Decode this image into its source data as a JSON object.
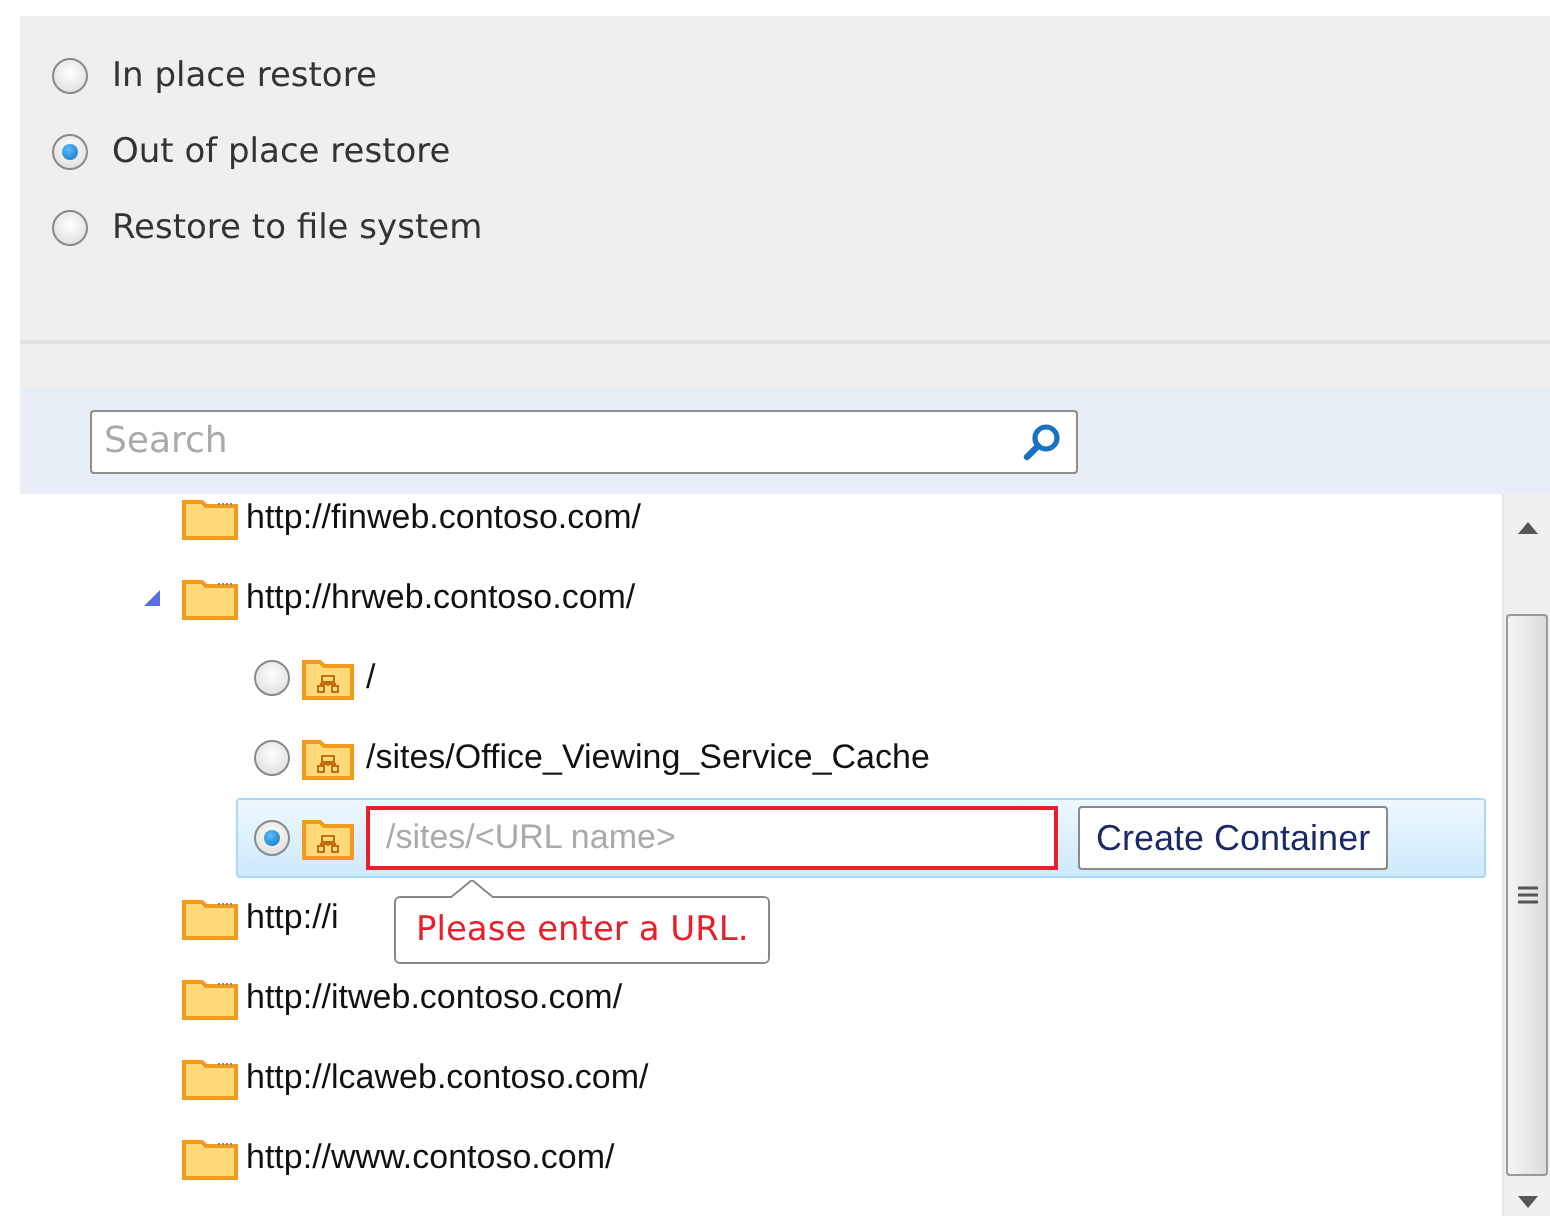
{
  "restore_options": [
    {
      "label": "In place restore",
      "selected": false
    },
    {
      "label": "Out of place restore",
      "selected": true
    },
    {
      "label": "Restore to file system",
      "selected": false
    }
  ],
  "search": {
    "placeholder": "Search"
  },
  "tree": [
    {
      "label": "http://finweb.contoso.com/",
      "expanded": false
    },
    {
      "label": "http://hrweb.contoso.com/",
      "expanded": true,
      "children": [
        {
          "kind": "site",
          "label": "/",
          "selected": false
        },
        {
          "kind": "site",
          "label": "/sites/Office_Viewing_Service_Cache",
          "selected": false
        },
        {
          "kind": "new",
          "placeholder": "/sites/<URL name>",
          "button": "Create Container",
          "error": "Please enter a URL.",
          "selected": true
        }
      ]
    },
    {
      "label": "http://i",
      "expanded": false
    },
    {
      "label": "http://itweb.contoso.com/",
      "expanded": false
    },
    {
      "label": "http://lcaweb.contoso.com/",
      "expanded": false
    },
    {
      "label": "http://www.contoso.com/",
      "expanded": false
    }
  ]
}
